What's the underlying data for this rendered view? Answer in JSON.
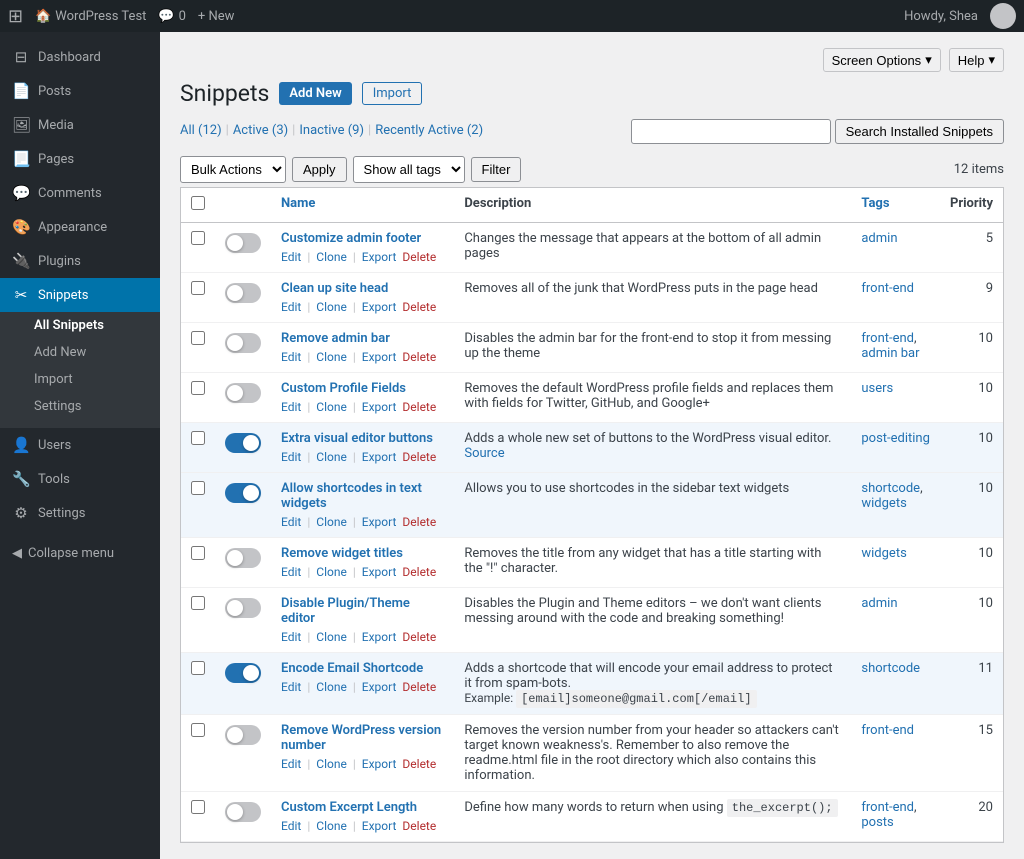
{
  "adminBar": {
    "wpLogo": "⊞",
    "siteName": "WordPress Test",
    "commentsLabel": "Comments",
    "commentsCount": "0",
    "newLabel": "+ New",
    "howdy": "Howdy, Shea"
  },
  "sidebar": {
    "items": [
      {
        "id": "dashboard",
        "label": "Dashboard",
        "icon": "⊟"
      },
      {
        "id": "posts",
        "label": "Posts",
        "icon": "📄"
      },
      {
        "id": "media",
        "label": "Media",
        "icon": "🖼"
      },
      {
        "id": "pages",
        "label": "Pages",
        "icon": "📃"
      },
      {
        "id": "comments",
        "label": "Comments",
        "icon": "💬"
      },
      {
        "id": "appearance",
        "label": "Appearance",
        "icon": "🎨"
      },
      {
        "id": "plugins",
        "label": "Plugins",
        "icon": "🔌"
      },
      {
        "id": "snippets",
        "label": "Snippets",
        "icon": "✂"
      }
    ],
    "snippetsSubItems": [
      {
        "id": "all-snippets",
        "label": "All Snippets"
      },
      {
        "id": "add-new",
        "label": "Add New"
      },
      {
        "id": "import",
        "label": "Import"
      },
      {
        "id": "settings",
        "label": "Settings"
      }
    ],
    "bottomItems": [
      {
        "id": "users",
        "label": "Users",
        "icon": "👤"
      },
      {
        "id": "tools",
        "label": "Tools",
        "icon": "🔧"
      },
      {
        "id": "settings",
        "label": "Settings",
        "icon": "⚙"
      }
    ],
    "collapseLabel": "Collapse menu"
  },
  "header": {
    "title": "Snippets",
    "addNewLabel": "Add New",
    "importLabel": "Import",
    "screenOptionsLabel": "Screen Options",
    "helpLabel": "Help"
  },
  "filterLinks": [
    {
      "id": "all",
      "label": "All",
      "count": "(12)"
    },
    {
      "id": "active",
      "label": "Active",
      "count": "(3)"
    },
    {
      "id": "inactive",
      "label": "Inactive",
      "count": "(9)"
    },
    {
      "id": "recently-active",
      "label": "Recently Active",
      "count": "(2)"
    }
  ],
  "search": {
    "placeholder": "",
    "btnLabel": "Search Installed Snippets"
  },
  "toolbar": {
    "bulkActionsLabel": "Bulk Actions",
    "applyLabel": "Apply",
    "showAllTagsLabel": "Show all tags",
    "filterLabel": "Filter",
    "itemsCount": "12 items"
  },
  "tableHeaders": {
    "name": "Name",
    "description": "Description",
    "tags": "Tags",
    "priority": "Priority"
  },
  "snippets": [
    {
      "id": 1,
      "name": "Customize admin footer",
      "active": false,
      "description": "Changes the message that appears at the bottom of all admin pages",
      "tags": [
        "admin"
      ],
      "priority": "5",
      "actions": [
        "Edit",
        "Clone",
        "Export",
        "Delete"
      ],
      "source": null,
      "extra": null,
      "rowActive": false
    },
    {
      "id": 2,
      "name": "Clean up site head",
      "active": false,
      "description": "Removes all of the junk that WordPress puts in the page head",
      "tags": [
        "front-end"
      ],
      "priority": "9",
      "actions": [
        "Edit",
        "Clone",
        "Export",
        "Delete"
      ],
      "source": null,
      "extra": null,
      "rowActive": false
    },
    {
      "id": 3,
      "name": "Remove admin bar",
      "active": false,
      "description": "Disables the admin bar for the front-end to stop it from messing up the theme",
      "tags": [
        "front-end",
        "admin bar"
      ],
      "priority": "10",
      "actions": [
        "Edit",
        "Clone",
        "Export",
        "Delete"
      ],
      "source": null,
      "extra": null,
      "rowActive": false
    },
    {
      "id": 4,
      "name": "Custom Profile Fields",
      "active": false,
      "description": "Removes the default WordPress profile fields and replaces them with fields for Twitter, GitHub, and Google+",
      "tags": [
        "users"
      ],
      "priority": "10",
      "actions": [
        "Edit",
        "Clone",
        "Export",
        "Delete"
      ],
      "source": null,
      "extra": null,
      "rowActive": false
    },
    {
      "id": 5,
      "name": "Extra visual editor buttons",
      "active": true,
      "description": "Adds a whole new set of buttons to the WordPress visual editor.",
      "tags": [
        "post-editing"
      ],
      "priority": "10",
      "actions": [
        "Edit",
        "Clone",
        "Export",
        "Delete"
      ],
      "source": "Source",
      "extra": null,
      "rowActive": true
    },
    {
      "id": 6,
      "name": "Allow shortcodes in text widgets",
      "active": true,
      "description": "Allows you to use shortcodes in the sidebar text widgets",
      "tags": [
        "shortcode",
        "widgets"
      ],
      "priority": "10",
      "actions": [
        "Edit",
        "Clone",
        "Export",
        "Delete"
      ],
      "source": null,
      "extra": null,
      "rowActive": true
    },
    {
      "id": 7,
      "name": "Remove widget titles",
      "active": false,
      "description": "Removes the title from any widget that has a title starting with the \"!\" character.",
      "tags": [
        "widgets"
      ],
      "priority": "10",
      "actions": [
        "Edit",
        "Clone",
        "Export",
        "Delete"
      ],
      "source": null,
      "extra": null,
      "rowActive": false
    },
    {
      "id": 8,
      "name": "Disable Plugin/Theme editor",
      "active": false,
      "description": "Disables the Plugin and Theme editors – we don't want clients messing around with the code and breaking something!",
      "tags": [
        "admin"
      ],
      "priority": "10",
      "actions": [
        "Edit",
        "Clone",
        "Export",
        "Delete"
      ],
      "source": null,
      "extra": null,
      "rowActive": false
    },
    {
      "id": 9,
      "name": "Encode Email Shortcode",
      "active": true,
      "description": "Adds a shortcode that will encode your email address to protect it from spam-bots.",
      "extraLine": "Example: [email]someone@gmail.com[/email]",
      "tags": [
        "shortcode"
      ],
      "priority": "11",
      "actions": [
        "Edit",
        "Clone",
        "Export",
        "Delete"
      ],
      "source": null,
      "rowActive": true
    },
    {
      "id": 10,
      "name": "Remove WordPress version number",
      "active": false,
      "description": "Removes the version number from your header so attackers can't target known weakness's. Remember to also remove the readme.html file in the root directory which also contains this information.",
      "tags": [
        "front-end"
      ],
      "priority": "15",
      "actions": [
        "Edit",
        "Clone",
        "Export",
        "Delete"
      ],
      "source": null,
      "extra": null,
      "rowActive": false
    },
    {
      "id": 11,
      "name": "Custom Excerpt Length",
      "active": false,
      "description": "Define how many words to return when using",
      "descriptionCode": "the_excerpt();",
      "tags": [
        "front-end",
        "posts"
      ],
      "priority": "20",
      "actions": [
        "Edit",
        "Clone",
        "Export",
        "Delete"
      ],
      "source": null,
      "rowActive": false
    }
  ]
}
